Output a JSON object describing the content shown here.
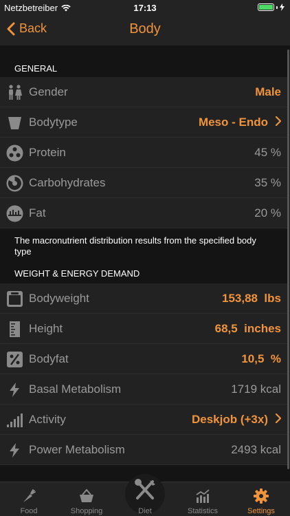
{
  "status": {
    "carrier": "Netzbetreiber",
    "time": "17:13"
  },
  "nav": {
    "back_label": "Back",
    "title": "Body"
  },
  "general": {
    "header": "GENERAL",
    "rows": [
      {
        "label": "Gender",
        "value": "Male",
        "icon": "gender-icon"
      },
      {
        "label": "Bodytype",
        "value": "Meso - Endo",
        "icon": "bodytype-icon"
      },
      {
        "label": "Protein",
        "value": "45 %",
        "icon": "protein-icon"
      },
      {
        "label": "Carbohydrates",
        "value": "35 %",
        "icon": "carbohydrates-icon"
      },
      {
        "label": "Fat",
        "value": "20 %",
        "icon": "fat-icon"
      }
    ],
    "note": "The macronutrient distribution results from the specified body type"
  },
  "weight": {
    "header": "WEIGHT & ENERGY DEMAND",
    "rows": [
      {
        "label": "Bodyweight",
        "value": "153,88  lbs",
        "icon": "scale-icon"
      },
      {
        "label": "Height",
        "value": "68,5  inches",
        "icon": "height-icon"
      },
      {
        "label": "Bodyfat",
        "value": "10,5  %",
        "icon": "percent-icon"
      },
      {
        "label": "Basal Metabolism",
        "value": "1719 kcal",
        "icon": "lightning-icon"
      },
      {
        "label": "Activity",
        "value": "Deskjob (+3x)",
        "icon": "activity-bars-icon"
      },
      {
        "label": "Power Metabolism",
        "value": "2493 kcal",
        "icon": "lightning-icon"
      }
    ]
  },
  "tabs": [
    {
      "label": "Food",
      "icon": "carrot-icon"
    },
    {
      "label": "Shopping",
      "icon": "basket-icon"
    },
    {
      "label": "Diet",
      "icon": "fork-knife-icon"
    },
    {
      "label": "Statistics",
      "icon": "statistics-icon"
    },
    {
      "label": "Settings",
      "icon": "gear-icon"
    }
  ],
  "colors": {
    "accent": "#f0943c",
    "battery": "#4cd964"
  }
}
